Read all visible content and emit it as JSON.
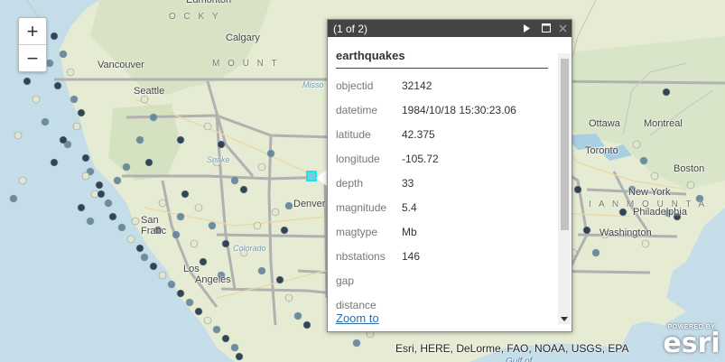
{
  "map": {
    "labels": [
      {
        "text": "Edmonton",
        "cls": ""
      },
      {
        "text": "Calgary",
        "cls": ""
      },
      {
        "text": "Vancouver",
        "cls": ""
      },
      {
        "text": "Seattle",
        "cls": ""
      },
      {
        "text": "San",
        "cls": ""
      },
      {
        "text": "Franc",
        "cls": ""
      },
      {
        "text": "Los",
        "cls": ""
      },
      {
        "text": "Angeles",
        "cls": ""
      },
      {
        "text": "Denver",
        "cls": ""
      },
      {
        "text": "Ottawa",
        "cls": ""
      },
      {
        "text": "Montreal",
        "cls": ""
      },
      {
        "text": "Toronto",
        "cls": ""
      },
      {
        "text": "Boston",
        "cls": ""
      },
      {
        "text": "New York",
        "cls": ""
      },
      {
        "text": "Philadelphia",
        "cls": ""
      },
      {
        "text": "Washington",
        "cls": ""
      },
      {
        "text": "O C K Y",
        "cls": "range"
      },
      {
        "text": "M O U N T",
        "cls": "range"
      },
      {
        "text": "I A N  M O U N T A",
        "cls": "range"
      },
      {
        "text": "Snake",
        "cls": "river"
      },
      {
        "text": "Colorado",
        "cls": "river"
      },
      {
        "text": "Misso",
        "cls": "river"
      },
      {
        "text": "Gulf of",
        "cls": "water"
      }
    ]
  },
  "zoom": {
    "in": "+",
    "out": "−"
  },
  "popup": {
    "title": "(1 of 2)",
    "heading": "earthquakes",
    "fields": [
      {
        "name": "objectid",
        "value": "32142"
      },
      {
        "name": "datetime",
        "value": "1984/10/18 15:30:23.06"
      },
      {
        "name": "latitude",
        "value": "42.375"
      },
      {
        "name": "longitude",
        "value": "-105.72"
      },
      {
        "name": "depth",
        "value": "33"
      },
      {
        "name": "magnitude",
        "value": "5.4"
      },
      {
        "name": "magtype",
        "value": "Mb"
      },
      {
        "name": "nbstations",
        "value": "146"
      },
      {
        "name": "gap",
        "value": ""
      },
      {
        "name": "distance",
        "value": ""
      }
    ],
    "zoom_link": "Zoom to"
  },
  "attribution": "Esri, HERE, DeLorme, FAO, NOAA, USGS, EPA",
  "logo": {
    "powered_by": "POWERED BY",
    "brand": "esri"
  },
  "icons": {
    "next": "next-arrow-icon",
    "maximize": "maximize-icon",
    "close": "close-icon"
  },
  "colors": {
    "dark_point": "#1f3347",
    "mid_point": "#5f8499",
    "light_point": "#e5e8c8",
    "selected": "#21e3e3",
    "popup_title_bg": "#444444"
  }
}
